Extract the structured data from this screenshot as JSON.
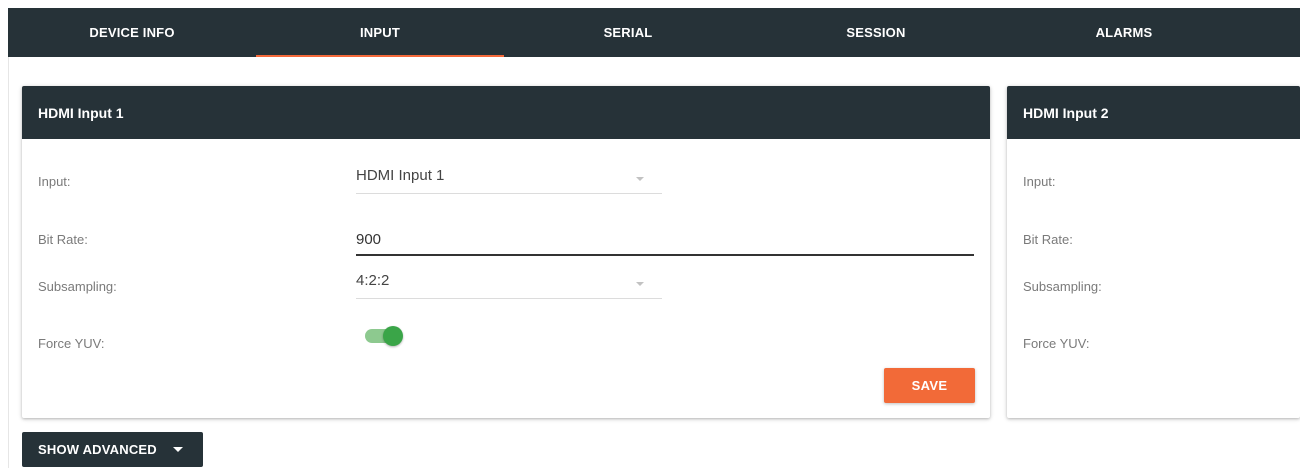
{
  "tabs": [
    {
      "label": "DEVICE INFO",
      "active": false
    },
    {
      "label": "INPUT",
      "active": true
    },
    {
      "label": "SERIAL",
      "active": false
    },
    {
      "label": "SESSION",
      "active": false
    },
    {
      "label": "ALARMS",
      "active": false
    }
  ],
  "card1": {
    "title": "HDMI Input 1",
    "input_label": "Input:",
    "input_value": "HDMI Input 1",
    "bitrate_label": "Bit Rate:",
    "bitrate_value": "900",
    "subsampling_label": "Subsampling:",
    "subsampling_value": "4:2:2",
    "force_yuv_label": "Force YUV:",
    "force_yuv_on": true,
    "save_label": "SAVE"
  },
  "card2": {
    "title": "HDMI Input 2",
    "input_label": "Input:",
    "bitrate_label": "Bit Rate:",
    "subsampling_label": "Subsampling:",
    "force_yuv_label": "Force YUV:"
  },
  "advanced_label": "SHOW ADVANCED",
  "icons": {
    "dropdown": "chevron-down-icon",
    "advanced": "caret-down-icon"
  },
  "colors": {
    "nav_bg": "#263238",
    "accent": "#f26a38",
    "toggle_on": "#3aa548"
  }
}
